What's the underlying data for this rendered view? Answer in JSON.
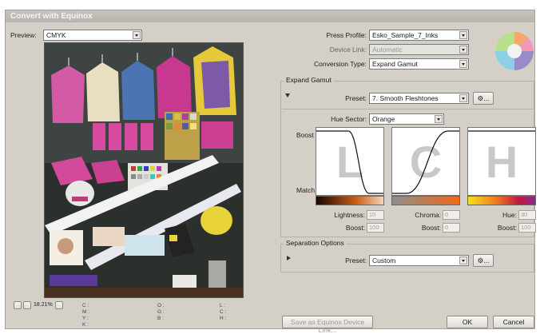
{
  "window": {
    "title": "Convert with Equinox"
  },
  "preview": {
    "label": "Preview:",
    "value": "CMYK"
  },
  "press_profile": {
    "label": "Press Profile:",
    "value": "Esko_Sample_7_Inks"
  },
  "device_link": {
    "label": "Device Link:",
    "value": "Automatic"
  },
  "conversion_type": {
    "label": "Conversion Type:",
    "value": "Expand Gamut"
  },
  "expand_gamut": {
    "title": "Expand Gamut",
    "preset_label": "Preset:",
    "preset_value": "7. Smooth Fleshtones",
    "hue_sector_label": "Hue Sector:",
    "hue_sector_value": "Orange",
    "boost_label": "Boost",
    "match_label": "Match",
    "curves": [
      {
        "letter": "L"
      },
      {
        "letter": "C"
      },
      {
        "letter": "H"
      }
    ],
    "lightness_label": "Lightness:",
    "lightness_value": "10",
    "chroma_label": "Chroma:",
    "chroma_value": "0",
    "hue_label": "Hue:",
    "hue_value": "30",
    "boost1_label": "Boost:",
    "boost1_value": "100",
    "boost2_label": "Boost:",
    "boost2_value": "0",
    "boost3_label": "Boost:",
    "boost3_value": "100"
  },
  "separation": {
    "title": "Separation Options",
    "preset_label": "Preset:",
    "preset_value": "Custom"
  },
  "zoom": {
    "value": "18.21%"
  },
  "readout": {
    "c": "C :",
    "m": "M :",
    "y": "Y :",
    "k": "K :",
    "o": "O :",
    "g": "G :",
    "b": "B :",
    "l": "L :",
    "cc": "C :",
    "h": "H :"
  },
  "buttons": {
    "save_device_link": "Save as Equinox Device Link...",
    "ok": "OK",
    "cancel": "Cancel",
    "options": "..."
  },
  "colors": {
    "window_bg": "#d4d0c8",
    "lightness_grad": [
      "#1a0600",
      "#c9601a",
      "#f3d6b8"
    ],
    "chroma_grad": [
      "#8e8e8e",
      "#f06a18"
    ],
    "hue_grad": [
      "#f5e018",
      "#f08020",
      "#c01840",
      "#8a2a8a"
    ]
  }
}
